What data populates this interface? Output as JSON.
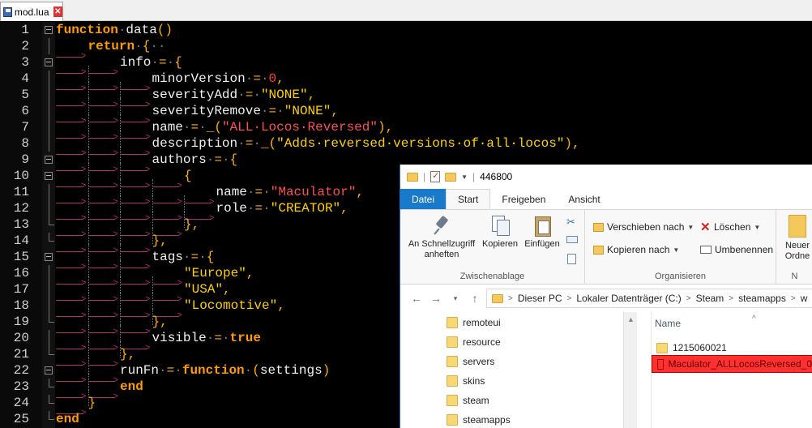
{
  "editor": {
    "tab_title": "mod.lua",
    "close_glyph": "✕"
  },
  "code_lines": [
    {
      "n": "1",
      "fold": "minus",
      "indent": 0,
      "tokens": [
        [
          "kw",
          "function"
        ],
        [
          "dot",
          "·"
        ],
        [
          "fn",
          "data"
        ],
        [
          "op",
          "()"
        ]
      ]
    },
    {
      "n": "2",
      "fold": "line",
      "indent": 1,
      "tokens": [
        [
          "kw",
          "return"
        ],
        [
          "dot",
          "·"
        ],
        [
          "op",
          "{"
        ],
        [
          "dot",
          "··"
        ]
      ]
    },
    {
      "n": "3",
      "fold": "minus",
      "indent": 2,
      "tokens": [
        [
          "id",
          "info"
        ],
        [
          "dot",
          "·"
        ],
        [
          "op",
          "="
        ],
        [
          "dot",
          "·"
        ],
        [
          "op",
          "{"
        ]
      ]
    },
    {
      "n": "4",
      "fold": "line",
      "indent": 3,
      "tokens": [
        [
          "id",
          "minorVersion"
        ],
        [
          "dot",
          "·"
        ],
        [
          "op",
          "="
        ],
        [
          "dot",
          "·"
        ],
        [
          "num",
          "0"
        ],
        [
          "op",
          ","
        ]
      ]
    },
    {
      "n": "5",
      "fold": "line",
      "indent": 3,
      "tokens": [
        [
          "id",
          "severityAdd"
        ],
        [
          "dot",
          "·"
        ],
        [
          "op",
          "="
        ],
        [
          "dot",
          "·"
        ],
        [
          "str",
          "\"NONE\""
        ],
        [
          "op",
          ","
        ]
      ]
    },
    {
      "n": "6",
      "fold": "line",
      "indent": 3,
      "tokens": [
        [
          "id",
          "severityRemove"
        ],
        [
          "dot",
          "·"
        ],
        [
          "op",
          "="
        ],
        [
          "dot",
          "·"
        ],
        [
          "str",
          "\"NONE\""
        ],
        [
          "op",
          ","
        ]
      ]
    },
    {
      "n": "7",
      "fold": "line",
      "indent": 3,
      "tokens": [
        [
          "id",
          "name"
        ],
        [
          "dot",
          "·"
        ],
        [
          "op",
          "="
        ],
        [
          "dot",
          "·"
        ],
        [
          "op",
          "_("
        ],
        [
          "str2",
          "\"ALL·Locos·Reversed\""
        ],
        [
          "op",
          "),"
        ]
      ]
    },
    {
      "n": "8",
      "fold": "line",
      "indent": 3,
      "tokens": [
        [
          "id",
          "description"
        ],
        [
          "dot",
          "·"
        ],
        [
          "op",
          "="
        ],
        [
          "dot",
          "·"
        ],
        [
          "op",
          "_("
        ],
        [
          "str",
          "\"Adds·reversed·versions·of·all·locos\""
        ],
        [
          "op",
          "),"
        ]
      ]
    },
    {
      "n": "9",
      "fold": "minus",
      "indent": 3,
      "tokens": [
        [
          "id",
          "authors"
        ],
        [
          "dot",
          "·"
        ],
        [
          "op",
          "="
        ],
        [
          "dot",
          "·"
        ],
        [
          "op",
          "{"
        ]
      ]
    },
    {
      "n": "10",
      "fold": "minus",
      "indent": 4,
      "tokens": [
        [
          "op",
          "{"
        ]
      ]
    },
    {
      "n": "11",
      "fold": "line",
      "indent": 5,
      "tokens": [
        [
          "id",
          "name"
        ],
        [
          "dot",
          "·"
        ],
        [
          "op",
          "="
        ],
        [
          "dot",
          "·"
        ],
        [
          "str2",
          "\"Maculator\""
        ],
        [
          "op",
          ","
        ]
      ]
    },
    {
      "n": "12",
      "fold": "line",
      "indent": 5,
      "tokens": [
        [
          "id",
          "role"
        ],
        [
          "dot",
          "·"
        ],
        [
          "op",
          "="
        ],
        [
          "dot",
          "·"
        ],
        [
          "str",
          "\"CREATOR\""
        ],
        [
          "op",
          ","
        ]
      ]
    },
    {
      "n": "13",
      "fold": "end",
      "indent": 4,
      "tokens": [
        [
          "op",
          "},"
        ]
      ]
    },
    {
      "n": "14",
      "fold": "end",
      "indent": 3,
      "tokens": [
        [
          "op",
          "},"
        ]
      ]
    },
    {
      "n": "15",
      "fold": "minus",
      "indent": 3,
      "tokens": [
        [
          "id",
          "tags"
        ],
        [
          "dot",
          "·"
        ],
        [
          "op",
          "="
        ],
        [
          "dot",
          "·"
        ],
        [
          "op",
          "{"
        ]
      ]
    },
    {
      "n": "16",
      "fold": "line",
      "indent": 4,
      "tokens": [
        [
          "str",
          "\"Europe\""
        ],
        [
          "op",
          ","
        ]
      ]
    },
    {
      "n": "17",
      "fold": "line",
      "indent": 4,
      "tokens": [
        [
          "str",
          "\"USA\""
        ],
        [
          "op",
          ","
        ]
      ]
    },
    {
      "n": "18",
      "fold": "line",
      "indent": 4,
      "tokens": [
        [
          "str",
          "\"Locomotive\""
        ],
        [
          "op",
          ","
        ]
      ]
    },
    {
      "n": "19",
      "fold": "end",
      "indent": 3,
      "tokens": [
        [
          "op",
          "},"
        ]
      ]
    },
    {
      "n": "20",
      "fold": "line",
      "indent": 3,
      "tokens": [
        [
          "id",
          "visible"
        ],
        [
          "dot",
          "·"
        ],
        [
          "op",
          "="
        ],
        [
          "dot",
          "·"
        ],
        [
          "kw",
          "true"
        ]
      ]
    },
    {
      "n": "21",
      "fold": "end",
      "indent": 2,
      "tokens": [
        [
          "op",
          "},"
        ]
      ]
    },
    {
      "n": "22",
      "fold": "minus",
      "indent": 2,
      "tokens": [
        [
          "id",
          "runFn"
        ],
        [
          "dot",
          "·"
        ],
        [
          "op",
          "="
        ],
        [
          "dot",
          "·"
        ],
        [
          "kw",
          "function"
        ],
        [
          "dot",
          "·"
        ],
        [
          "op",
          "("
        ],
        [
          "id",
          "settings"
        ],
        [
          "op",
          ")"
        ]
      ]
    },
    {
      "n": "23",
      "fold": "end",
      "indent": 2,
      "tokens": [
        [
          "kw",
          "end"
        ]
      ]
    },
    {
      "n": "24",
      "fold": "end",
      "indent": 1,
      "tokens": [
        [
          "op",
          "}"
        ]
      ]
    },
    {
      "n": "25",
      "fold": "end",
      "indent": 0,
      "tokens": [
        [
          "kw",
          "end"
        ]
      ]
    }
  ],
  "explorer": {
    "window_title": "446800",
    "ribbon_tabs": [
      "Datei",
      "Start",
      "Freigeben",
      "Ansicht"
    ],
    "clipboard": {
      "pin_label_1": "An Schnellzugriff",
      "pin_label_2": "anheften",
      "copy_label": "Kopieren",
      "paste_label": "Einfügen",
      "group_label": "Zwischenablage"
    },
    "organize": {
      "move_label": "Verschieben nach",
      "copy_to_label": "Kopieren nach",
      "delete_label": "Löschen",
      "rename_label": "Umbenennen",
      "group_label": "Organisieren"
    },
    "new_label_1": "Neuer",
    "new_label_2": "Ordne",
    "new_group_label": "N",
    "address": [
      "Dieser PC",
      "Lokaler Datenträger (C:)",
      "Steam",
      "steamapps",
      "w"
    ],
    "nav_items": [
      "remoteui",
      "resource",
      "servers",
      "skins",
      "steam",
      "steamapps"
    ],
    "column_name": "Name",
    "files": [
      {
        "name": "1215060021",
        "selected": false
      },
      {
        "name": "Maculator_ALLLocosReversed_0",
        "selected": true
      }
    ]
  }
}
